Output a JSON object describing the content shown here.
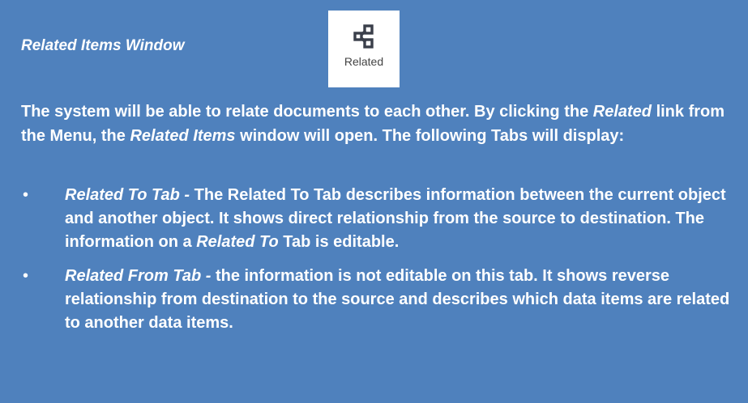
{
  "title": "Related Items Window",
  "related_button": {
    "label": "Related",
    "icon": "related-icon"
  },
  "intro": {
    "part1": "The system will be able to relate documents to each other. By clicking the ",
    "emph1": "Related",
    "part2": " link from the Menu, the ",
    "emph2": "Related Items",
    "part3": " window will open. The following Tabs will display:"
  },
  "bullets": [
    {
      "term": "Related To Tab -",
      "text1": " The Related To Tab describes information between the current object and another object. It shows direct relationship from the source to destination. The information on a ",
      "emph": "Related To",
      "text2": " Tab is editable."
    },
    {
      "term": "Related From Tab -",
      "text1": " the information is not editable on this tab. It shows reverse relationship from destination to the source and describes which data items are related to another data items.",
      "emph": "",
      "text2": ""
    }
  ],
  "colors": {
    "background": "#4f81bd",
    "text": "#ffffff",
    "icon": "#3a3f4a"
  }
}
